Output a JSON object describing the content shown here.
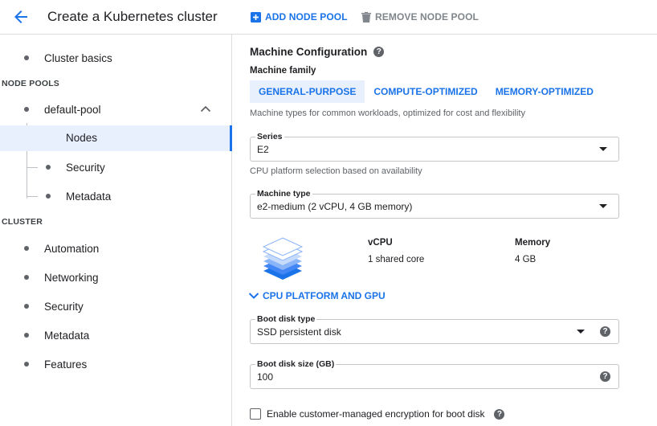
{
  "header": {
    "title": "Create a Kubernetes cluster",
    "add_node_pool": "ADD NODE POOL",
    "remove_node_pool": "REMOVE NODE POOL"
  },
  "sidebar": {
    "cluster_basics": "Cluster basics",
    "node_pools_label": "NODE POOLS",
    "default_pool": "default-pool",
    "pool_items": [
      "Nodes",
      "Security",
      "Metadata"
    ],
    "cluster_label": "CLUSTER",
    "cluster_items": [
      "Automation",
      "Networking",
      "Security",
      "Metadata",
      "Features"
    ]
  },
  "main": {
    "section_title": "Machine Configuration",
    "help_glyph": "?",
    "machine_family_label": "Machine family",
    "tabs": [
      "GENERAL-PURPOSE",
      "COMPUTE-OPTIMIZED",
      "MEMORY-OPTIMIZED"
    ],
    "active_tab": "GENERAL-PURPOSE",
    "family_hint": "Machine types for common workloads, optimized for cost and flexibility",
    "series": {
      "label": "Series",
      "value": "E2"
    },
    "series_hint": "CPU platform selection based on availability",
    "machine_type": {
      "label": "Machine type",
      "value": "e2-medium (2 vCPU, 4 GB memory)"
    },
    "specs": {
      "vcpu_header": "vCPU",
      "vcpu_value": "1 shared core",
      "memory_header": "Memory",
      "memory_value": "4 GB"
    },
    "cpu_platform_toggle": "CPU PLATFORM AND GPU",
    "boot_disk_type": {
      "label": "Boot disk type",
      "value": "SSD persistent disk"
    },
    "boot_disk_size": {
      "label": "Boot disk size (GB)",
      "value": "100"
    },
    "encryption_checkbox": {
      "label": "Enable customer-managed encryption for boot disk",
      "checked": false
    }
  },
  "colors": {
    "accent": "#1a73e8",
    "active_bg": "#e8f0fe",
    "border": "#dadce0",
    "muted_text": "#5f6368"
  }
}
